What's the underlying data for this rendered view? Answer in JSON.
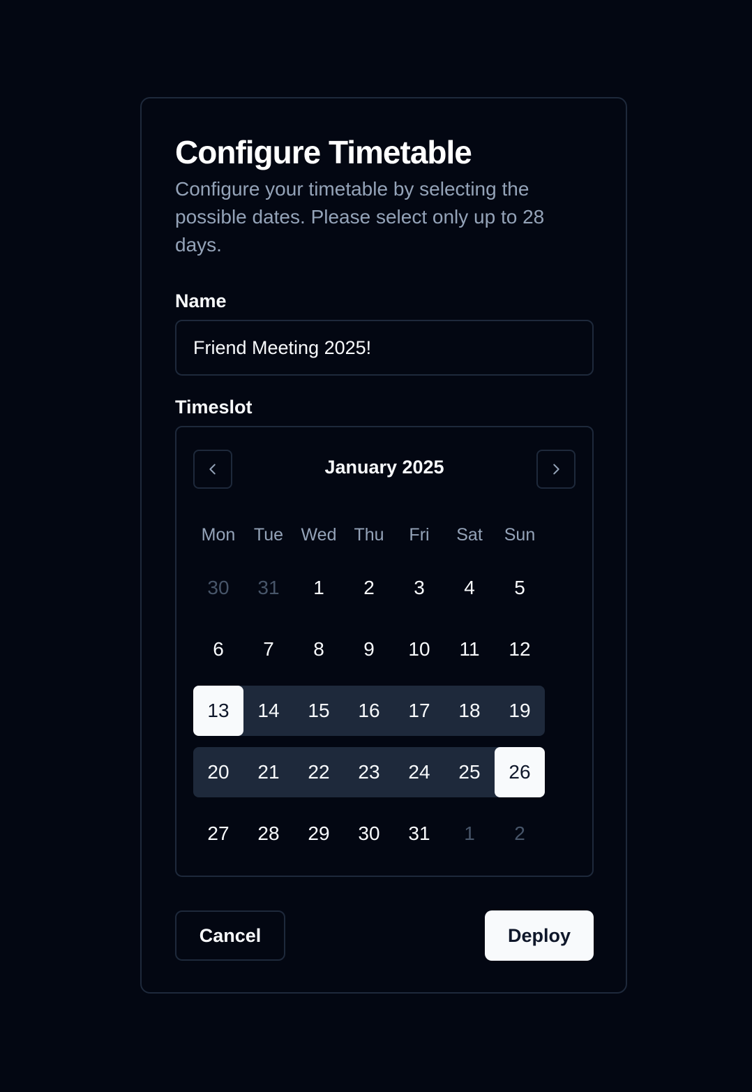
{
  "form": {
    "title": "Configure Timetable",
    "subtitle": "Configure your timetable by selecting the possible dates. Please select only up to 28 days.",
    "name_label": "Name",
    "name_value": "Friend Meeting 2025!",
    "timeslot_label": "Timeslot"
  },
  "calendar": {
    "month_label": "January 2025",
    "prev_icon": "chevron-left-icon",
    "next_icon": "chevron-right-icon",
    "weekdays": [
      "Mon",
      "Tue",
      "Wed",
      "Thu",
      "Fri",
      "Sat",
      "Sun"
    ],
    "weeks": [
      [
        "30",
        "31",
        "1",
        "2",
        "3",
        "4",
        "5"
      ],
      [
        "6",
        "7",
        "8",
        "9",
        "10",
        "11",
        "12"
      ],
      [
        "13",
        "14",
        "15",
        "16",
        "17",
        "18",
        "19"
      ],
      [
        "20",
        "21",
        "22",
        "23",
        "24",
        "25",
        "26"
      ],
      [
        "27",
        "28",
        "29",
        "30",
        "31",
        "1",
        "2"
      ]
    ],
    "range_start": "13",
    "range_end": "26"
  },
  "actions": {
    "cancel_label": "Cancel",
    "deploy_label": "Deploy"
  },
  "colors": {
    "background": "#030712",
    "border": "#1e293b",
    "range_fill": "#1e293b",
    "selected_fill": "#f8fafc",
    "muted_text": "#94a3b8",
    "outside_day_text": "#475569"
  }
}
